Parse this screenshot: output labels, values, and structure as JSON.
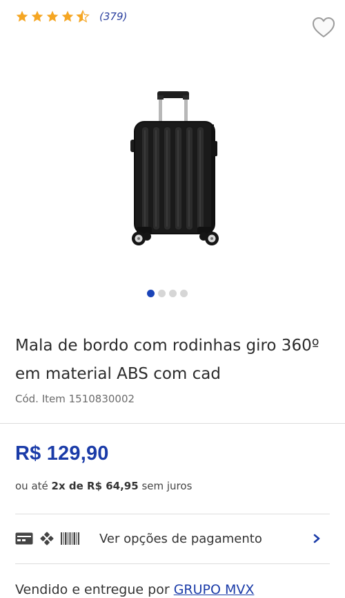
{
  "rating": {
    "stars": 4.5,
    "count_text": "(379)",
    "star_color": "#f5a623"
  },
  "favorite": {
    "icon": "heart-outline-icon"
  },
  "product": {
    "image_icon": "suitcase-image",
    "carousel": {
      "total": 4,
      "active": 1
    },
    "title": "Mala de bordo com rodinhas giro 360º em material ABS com cad",
    "code": "Cód. Item 1510830002"
  },
  "price": {
    "main": "R$ 129,90",
    "installments_prefix": "ou até",
    "installments_count": "2x de R$ 64,95",
    "installments_suffix": "sem juros",
    "color": "#1a3ba8"
  },
  "payment": {
    "icons": [
      "credit-card-icon",
      "pix-icon",
      "barcode-icon"
    ],
    "label": "Ver opções de pagamento"
  },
  "seller": {
    "prefix": "Vendido e entregue por",
    "name": "GRUPO MVX"
  }
}
